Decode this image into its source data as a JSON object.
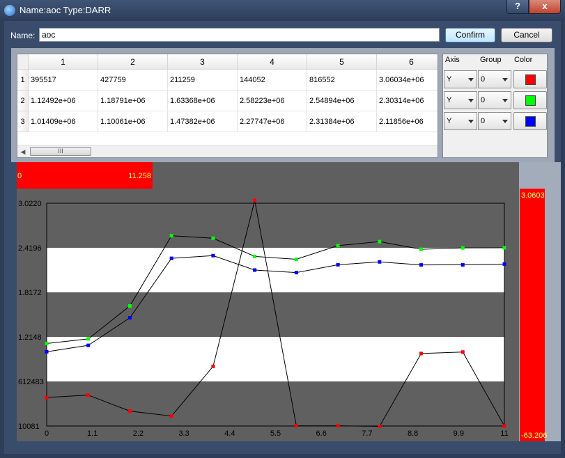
{
  "window": {
    "title": "Name:aoc Type:DARR",
    "help_label": "?",
    "close_label": "x"
  },
  "form": {
    "name_label": "Name:",
    "name_value": "aoc",
    "confirm_label": "Confirm",
    "cancel_label": "Cancel"
  },
  "table": {
    "columns": [
      "1",
      "2",
      "3",
      "4",
      "5",
      "6"
    ],
    "rows": [
      {
        "header": "1",
        "cells": [
          "395517",
          "427759",
          "211259",
          "144052",
          "816552",
          "3.06034e+06"
        ]
      },
      {
        "header": "2",
        "cells": [
          "1.12492e+06",
          "1.18791e+06",
          "1.63368e+06",
          "2.58223e+06",
          "2.54894e+06",
          "2.30314e+06"
        ]
      },
      {
        "header": "3",
        "cells": [
          "1.01409e+06",
          "1.10061e+06",
          "1.47382e+06",
          "2.27747e+06",
          "2.31384e+06",
          "2.11856e+06"
        ]
      }
    ],
    "scroll_thumb": "III"
  },
  "series_settings": {
    "headers": {
      "axis": "Axis",
      "group": "Group",
      "color": "Color"
    },
    "rows": [
      {
        "axis": "Y",
        "group": "0",
        "color": "#ff0000"
      },
      {
        "axis": "Y",
        "group": "0",
        "color": "#00ff00"
      },
      {
        "axis": "Y",
        "group": "0",
        "color": "#0000ff"
      }
    ]
  },
  "chart_data": {
    "type": "line",
    "x_range_box": {
      "min": "0",
      "max": "11.258"
    },
    "y_range_box": {
      "max": "3.0603",
      "min": "-63.206"
    },
    "x_ticks": [
      "0",
      "1.1",
      "2.2",
      "3.3",
      "4.4",
      "5.5",
      "6.6",
      "7.7",
      "8.8",
      "9.9",
      "11"
    ],
    "y_ticks": [
      "3.0220",
      "2.4196",
      "1.8172",
      "1.2148",
      "612483",
      "10081"
    ],
    "xlim": [
      0,
      11
    ],
    "ylim": [
      10081,
      3022000
    ],
    "x": [
      0,
      1,
      2,
      3,
      4,
      5,
      6,
      7,
      8,
      9,
      10,
      11
    ],
    "series": [
      {
        "color": "#ff0000",
        "values": [
          395517,
          427759,
          211259,
          144052,
          816552,
          3060340,
          13000,
          13000,
          5000,
          990000,
          1010000,
          10081
        ]
      },
      {
        "color": "#00ff00",
        "values": [
          1124920,
          1187910,
          1633680,
          2582230,
          2548940,
          2303140,
          2264000,
          2449000,
          2503000,
          2400000,
          2418000,
          2420000
        ]
      },
      {
        "color": "#0000ff",
        "values": [
          1014090,
          1100610,
          1473820,
          2277470,
          2313840,
          2118560,
          2084000,
          2190000,
          2229000,
          2188000,
          2189000,
          2200000
        ]
      }
    ],
    "bands": [
      {
        "from": 2419600,
        "to": 3022000,
        "color": "#606060"
      },
      {
        "from": 1817200,
        "to": 2419600,
        "color": "#ffffff"
      },
      {
        "from": 1214800,
        "to": 1817200,
        "color": "#606060"
      },
      {
        "from": 612483,
        "to": 1214800,
        "color": "#ffffff"
      },
      {
        "from": 10081,
        "to": 612483,
        "color": "#606060"
      }
    ]
  }
}
